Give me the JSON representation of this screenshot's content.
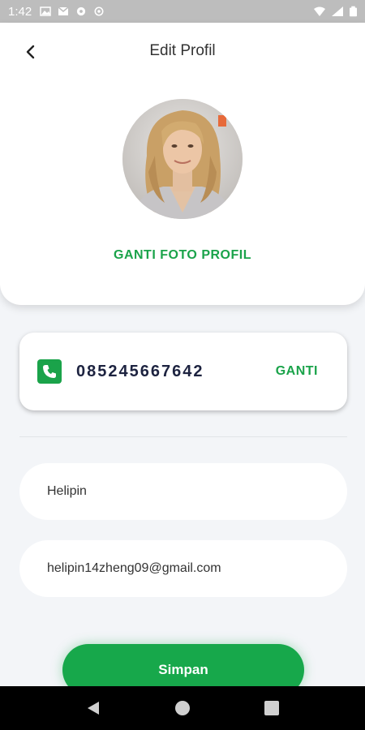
{
  "status_bar": {
    "time": "1:42",
    "left_icons": [
      "gallery-icon",
      "mail-icon",
      "football-icon",
      "sync-icon"
    ],
    "right_icons": [
      "wifi-icon",
      "signal-icon",
      "battery-icon"
    ]
  },
  "header": {
    "title": "Edit Profil",
    "change_photo_label": "GANTI FOTO PROFIL"
  },
  "phone": {
    "number": "085245667642",
    "change_label": "GANTI"
  },
  "form": {
    "name_value": "Helipin",
    "email_value": "helipin14zheng09@gmail.com",
    "save_label": "Simpan"
  },
  "colors": {
    "accent": "#1aa34a",
    "background": "#f3f5f8",
    "status_bar": "#bdbdbd"
  }
}
